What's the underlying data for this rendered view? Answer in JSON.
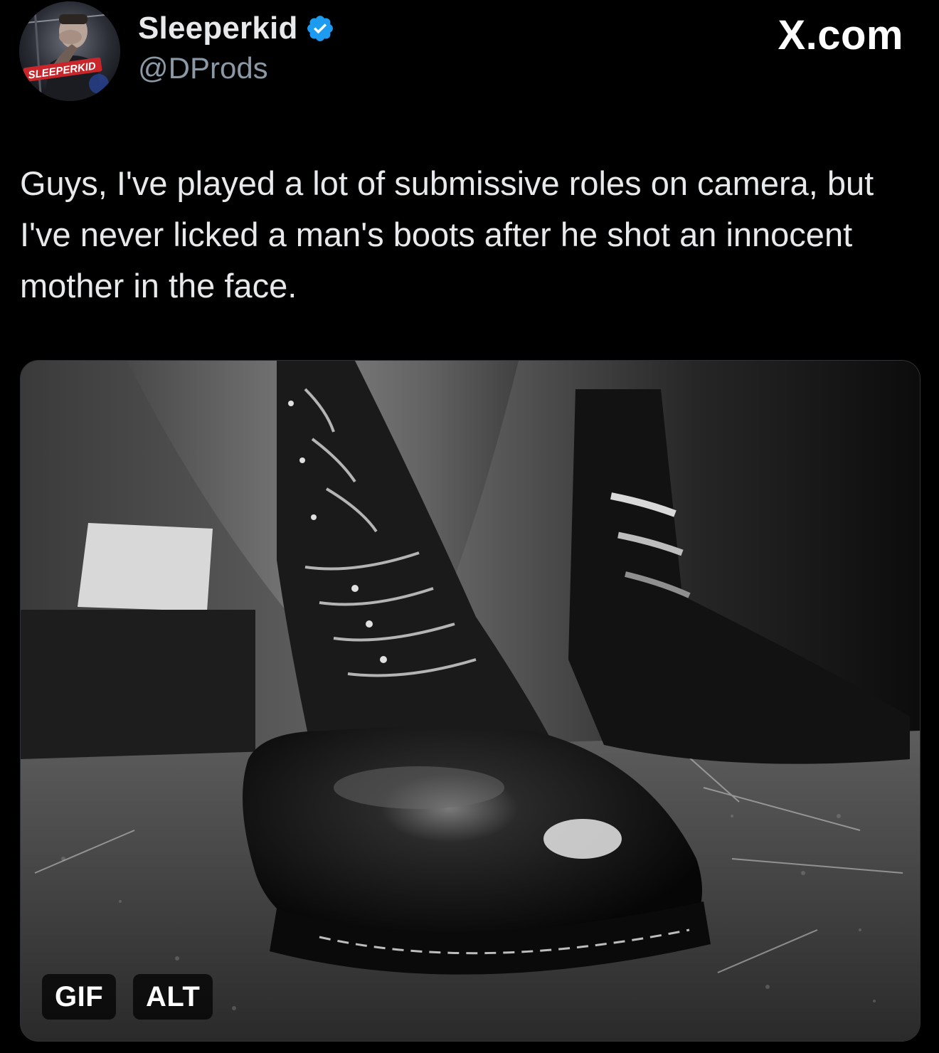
{
  "author": {
    "display_name": "Sleeperkid",
    "handle": "@DProds",
    "avatar_text": "SLEEPERKID",
    "verified_icon": "verified-badge-icon",
    "verified_color": "#1d9bf0"
  },
  "brand": {
    "label": "X.com"
  },
  "post": {
    "text": "Guys, I've played a lot of submissive roles on camera, but I've never licked a man's boots after he shot an innocent mother in the face."
  },
  "media": {
    "type": "gif",
    "gif_label": "GIF",
    "alt_label": "ALT"
  },
  "colors": {
    "background": "#000000",
    "text_primary": "#e7e9ea",
    "text_secondary": "#8b98a5",
    "accent": "#1d9bf0"
  }
}
